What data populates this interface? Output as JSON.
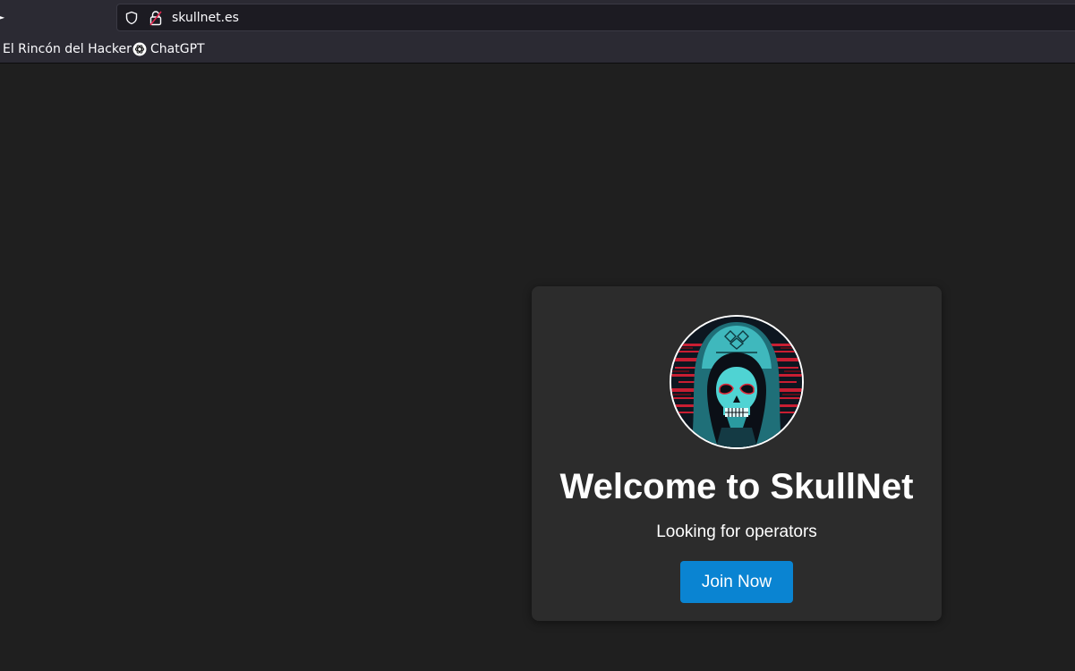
{
  "browser": {
    "url": "skullnet.es",
    "bookmarks": [
      {
        "label": "El Rincón del Hacker"
      },
      {
        "label": "ChatGPT",
        "icon": "chatgpt-icon"
      }
    ],
    "icons": {
      "tracking_protection": "shield-icon",
      "site_security": "lock-icon"
    }
  },
  "page": {
    "title": "Welcome to SkullNet",
    "subtitle": "Looking for operators",
    "cta_label": "Join Now",
    "logo": "hooded-skull-avatar"
  },
  "colors": {
    "page_background": "#1f1f1f",
    "card_background": "#2c2c2c",
    "button": "#0a84d2",
    "text": "#ffffff",
    "skull_accent": "#3fd0d0",
    "glitch_accent": "#d6283a"
  }
}
